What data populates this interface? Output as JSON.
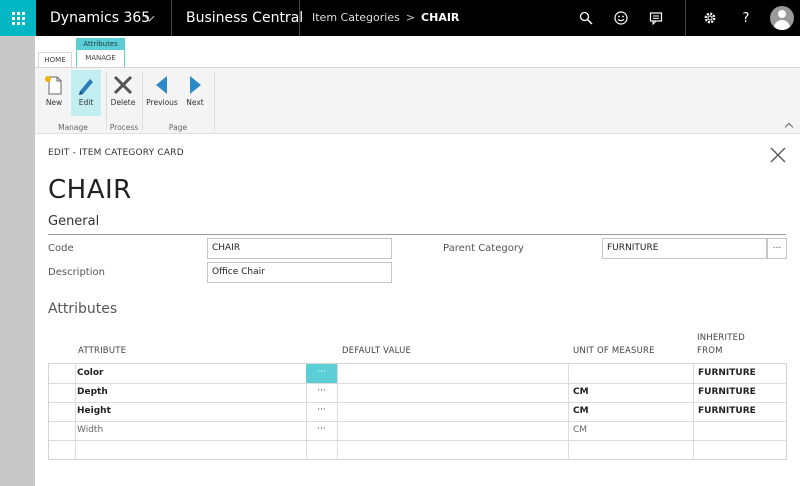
{
  "topbar": {
    "app_name": "Dynamics 365",
    "product": "Business Central",
    "breadcrumb_parent": "Item Categories",
    "breadcrumb_separator": ">",
    "breadcrumb_current": "CHAIR",
    "icons": [
      "search-icon",
      "smiley-icon",
      "chat-icon",
      "gear-icon",
      "help-icon",
      "avatar"
    ],
    "help_glyph": "?"
  },
  "ribbon": {
    "context_label": "Attributes",
    "tabs": [
      "HOME",
      "MANAGE"
    ],
    "buttons": {
      "new": "New",
      "edit": "Edit",
      "delete": "Delete",
      "previous": "Previous",
      "next": "Next"
    },
    "groups": {
      "manage": "Manage",
      "process": "Process",
      "page": "Page"
    }
  },
  "page": {
    "caption": "EDIT - ITEM CATEGORY CARD",
    "title": "CHAIR",
    "general_section": "General",
    "attributes_section": "Attributes"
  },
  "fields": {
    "code_label": "Code",
    "code_value": "CHAIR",
    "description_label": "Description",
    "description_value": "Office Chair",
    "parent_label": "Parent Category",
    "parent_value": "FURNITURE",
    "lookup_glyph": "..."
  },
  "attributes_table": {
    "headers": {
      "attribute": "ATTRIBUTE",
      "default_value": "DEFAULT VALUE",
      "unit": "UNIT OF MEASURE",
      "inherited_line1": "INHERITED",
      "inherited_line2": "FROM"
    },
    "dots_glyph": "···",
    "rows": [
      {
        "attribute": "Color",
        "unit": "",
        "inherited": "FURNITURE"
      },
      {
        "attribute": "Depth",
        "unit": "CM",
        "inherited": "FURNITURE"
      },
      {
        "attribute": "Height",
        "unit": "CM",
        "inherited": "FURNITURE"
      },
      {
        "attribute": "Width",
        "unit": "CM",
        "inherited": ""
      }
    ]
  },
  "colors": {
    "accent": "#00b7c3",
    "context_tab": "#5ccfd6",
    "topbar": "#000000"
  }
}
